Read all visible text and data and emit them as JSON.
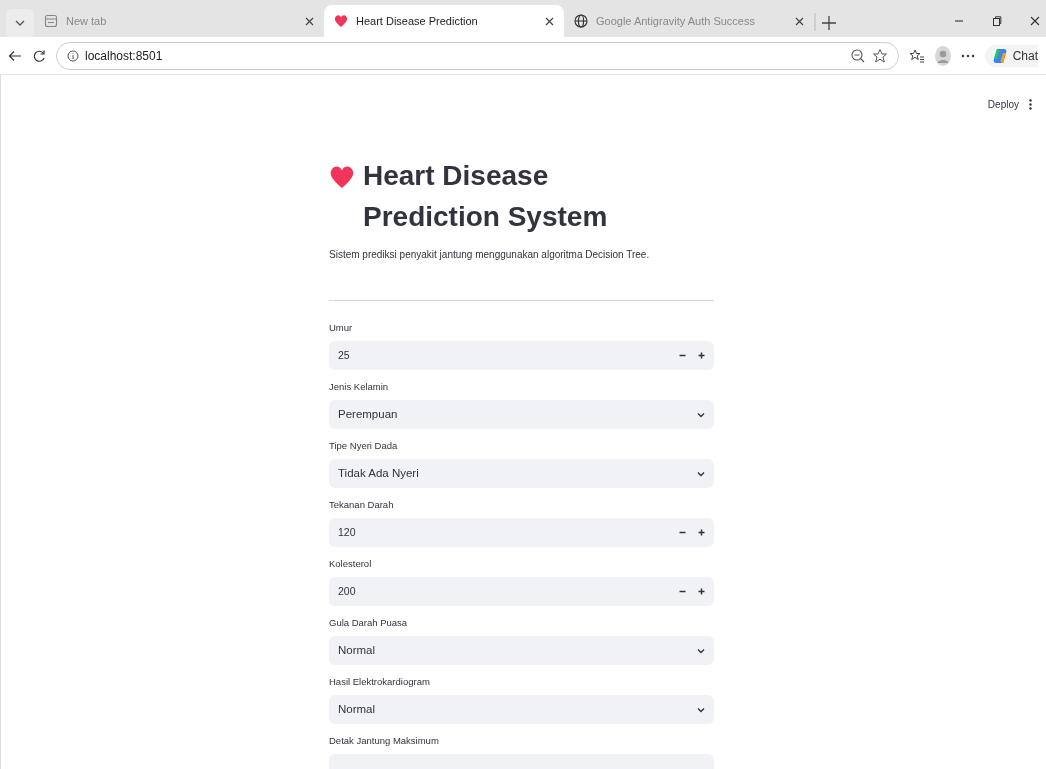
{
  "browser": {
    "tabs": [
      {
        "title": "New tab",
        "kind": "blank",
        "selected": false
      },
      {
        "title": "Heart Disease Prediction",
        "kind": "app",
        "selected": true
      },
      {
        "title": "Google Antigravity Auth Success",
        "kind": "web",
        "selected": false
      }
    ],
    "address": "localhost:8501",
    "chat_label": "Chat"
  },
  "app": {
    "deploy_label": "Deploy",
    "title": "Heart Disease Prediction System",
    "subtitle": "Sistem prediksi penyakit jantung menggunakan algoritma Decision Tree.",
    "fields": [
      {
        "label": "Umur",
        "kind": "number",
        "value": "25"
      },
      {
        "label": "Jenis Kelamin",
        "kind": "select",
        "value": "Perempuan"
      },
      {
        "label": "Tipe Nyeri Dada",
        "kind": "select",
        "value": "Tidak Ada Nyeri"
      },
      {
        "label": "Tekanan Darah",
        "kind": "number",
        "value": "120"
      },
      {
        "label": "Kolesterol",
        "kind": "number",
        "value": "200"
      },
      {
        "label": "Gula Darah Puasa",
        "kind": "select",
        "value": "Normal"
      },
      {
        "label": "Hasil Elektrokardiogram",
        "kind": "select",
        "value": "Normal"
      },
      {
        "label": "Detak Jantung Maksimum",
        "kind": "partial"
      }
    ]
  }
}
